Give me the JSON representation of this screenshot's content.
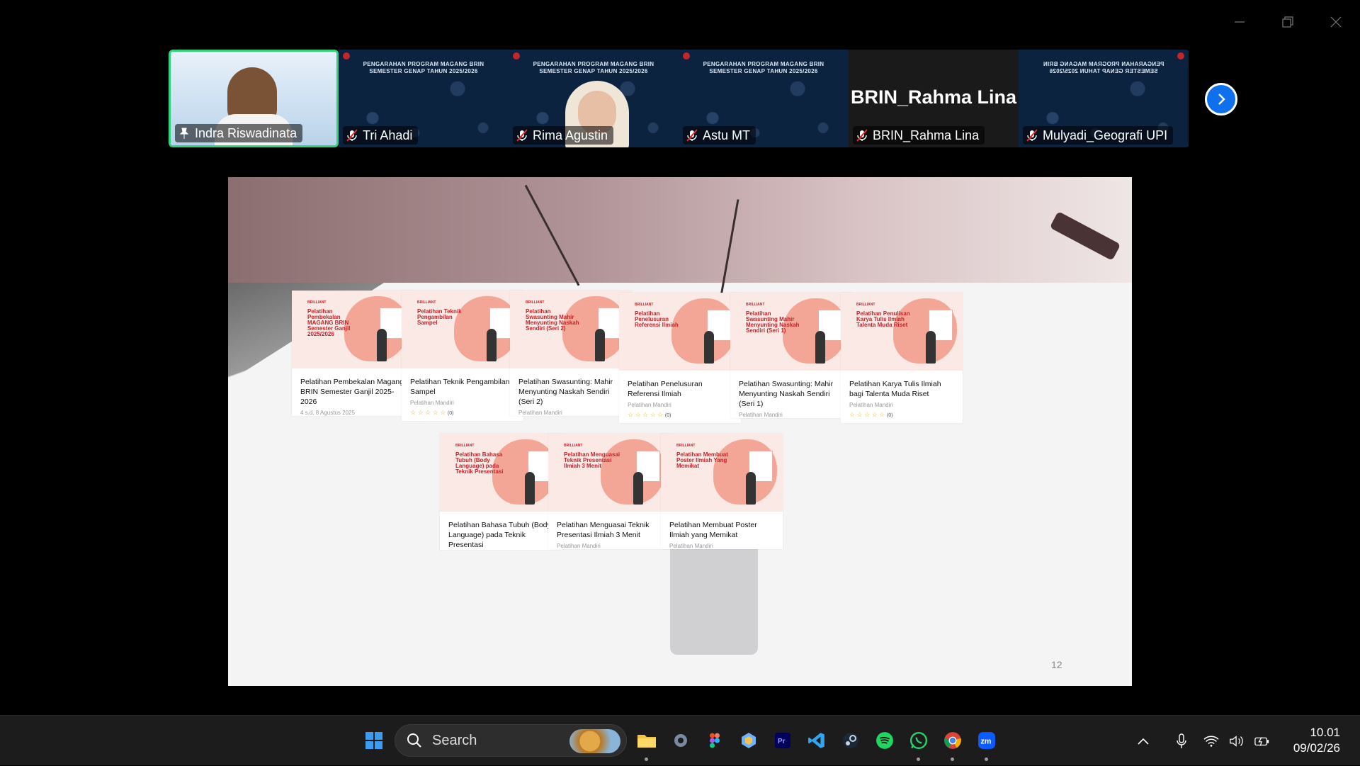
{
  "participants": [
    {
      "name": "Indra Riswadinata",
      "active": true,
      "pinned": true
    },
    {
      "name": "Tri Ahadi",
      "muted": true
    },
    {
      "name": "Rima Agustin",
      "muted": true
    },
    {
      "name": "Astu MT",
      "muted": true
    },
    {
      "name": "BRIN_Rahma Lina",
      "muted": true,
      "display_name": "BRIN_Rahma Lina"
    },
    {
      "name": "Mulyadi_Geografi UPI",
      "muted": true
    }
  ],
  "tile_banner": "PENGARAHAN PROGRAM MAGANG BRIN\nSEMESTER GENAP TAHUN 2025/2026",
  "slide": {
    "page_number": "12",
    "cards_row1": [
      {
        "thumb_title": "Pelatihan Pembekalan MAGANG BRIN Semester Ganjil 2025/2026",
        "title": "Pelatihan Pembekalan Magang BRIN Semester Ganjil 2025-2026",
        "meta": "4 s.d. 8 Agustus 2025",
        "stars": ""
      },
      {
        "thumb_title": "Pelatihan Teknik Pengambilan Sampel",
        "title": "Pelatihan Teknik Pengambilan Sampel",
        "meta": "Pelatihan Mandiri",
        "stars": "☆ ☆ ☆ ☆ ☆",
        "count": "(0)"
      },
      {
        "thumb_title": "Pelatihan Swasunting Mahir Menyunting Naskah Sendiri (Seri 2)",
        "title": "Pelatihan Swasunting: Mahir Menyunting Naskah Sendiri (Seri 2)",
        "meta": "Pelatihan Mandiri",
        "stars": ""
      },
      {
        "thumb_title": "Pelatihan Penelusuran Referensi Ilmiah",
        "title": "Pelatihan Penelusuran Referensi Ilmiah",
        "meta": "Pelatihan Mandiri",
        "stars": "☆ ☆ ☆ ☆ ☆",
        "count": "(0)"
      },
      {
        "thumb_title": "Pelatihan Swasunting Mahir Menyunting Naskah Sendiri (Seri 1)",
        "title": "Pelatihan Swasunting: Mahir Menyunting Naskah Sendiri (Seri 1)",
        "meta": "Pelatihan Mandiri",
        "stars": ""
      },
      {
        "thumb_title": "Pelatihan Penulisan Karya Tulis Ilmiah Talenta Muda Riset",
        "title": "Pelatihan Karya Tulis Ilmiah bagi Talenta Muda Riset",
        "meta": "Pelatihan Mandiri",
        "stars": "☆ ☆ ☆ ☆ ☆",
        "count": "(0)"
      }
    ],
    "cards_row2": [
      {
        "thumb_title": "Pelatihan Bahasa Tubuh (Body Language) pada Teknik Presentasi",
        "title": "Pelatihan Bahasa Tubuh (Body Language) pada Teknik Presentasi",
        "meta": "",
        "stars": ""
      },
      {
        "thumb_title": "Pelatihan Menguasai Teknik Presentasi Ilmiah 3 Menit",
        "title": "Pelatihan Menguasai Teknik Presentasi Ilmiah 3 Menit",
        "meta": "Pelatihan Mandiri",
        "stars": ""
      },
      {
        "thumb_title": "Pelatihan Membuat Poster Ilmiah Yang Memikat",
        "title": "Pelatihan Membuat Poster Ilmiah yang Memikat",
        "meta": "Pelatihan Mandiri",
        "stars": ""
      }
    ],
    "brand": "BRILLIANT"
  },
  "taskbar": {
    "search_label": "Search",
    "apps": [
      "start-icon",
      "file-explorer-icon",
      "settings-icon",
      "figma-icon",
      "app-icon",
      "premiere-icon",
      "vscode-icon",
      "steam-icon",
      "spotify-icon",
      "whatsapp-icon",
      "chrome-icon",
      "zoom-icon"
    ],
    "time": "10.01",
    "date": "09/02/26"
  },
  "colors": {
    "accent": "#0e71eb",
    "active_speaker": "#2ed47a",
    "brand_red": "#c4242b",
    "taskbar": "#1c1c1c"
  }
}
